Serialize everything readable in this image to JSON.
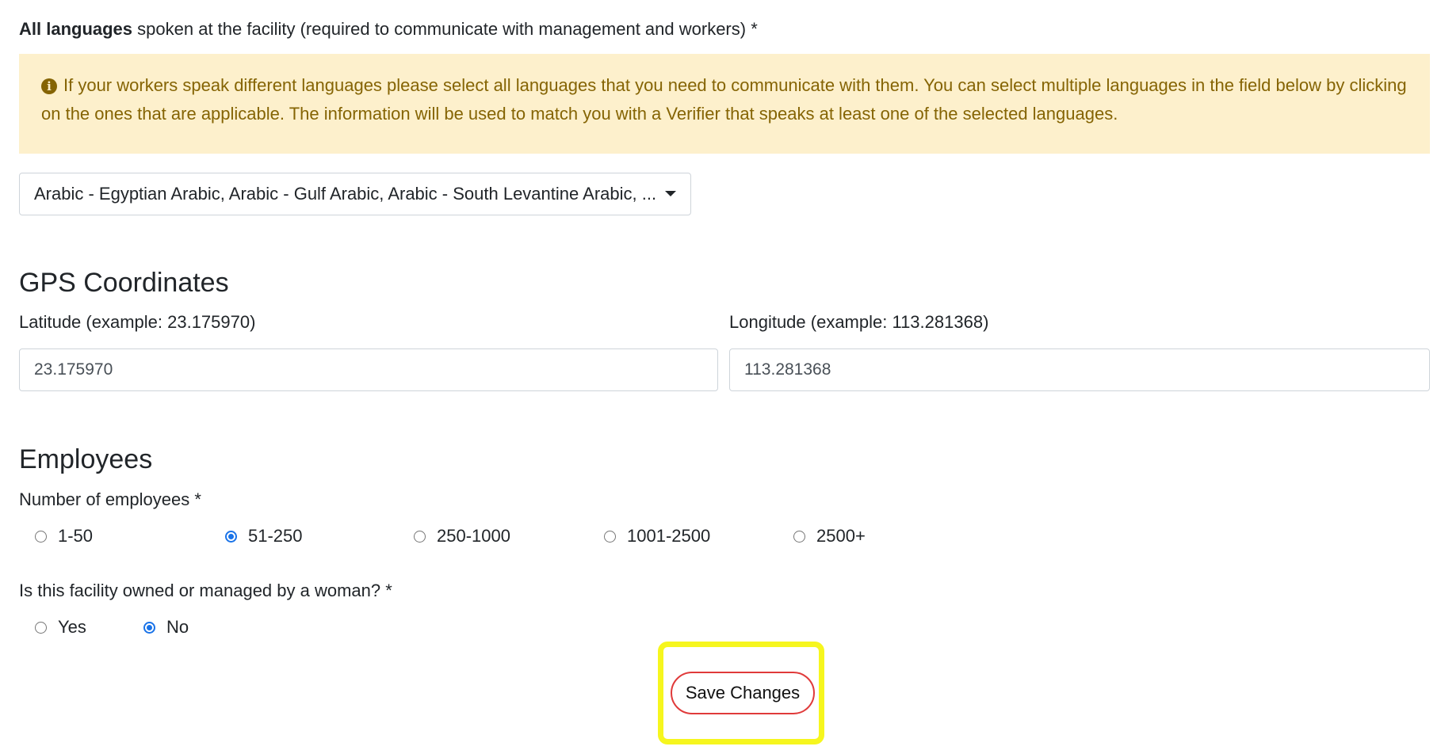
{
  "languages": {
    "label_bold": "All languages",
    "label_rest": " spoken at the facility (required to communicate with management and workers) *",
    "alert_text": "If your workers speak different languages please select all languages that you need to communicate with them. You can select multiple languages in the field below by clicking on the ones that are applicable. The information will be used to match you with a Verifier that speaks at least one of the selected languages.",
    "select_value": "Arabic - Egyptian Arabic, Arabic - Gulf Arabic, Arabic - South Levantine Arabic, ...",
    "info_icon_glyph": "i"
  },
  "gps": {
    "title": "GPS Coordinates",
    "latitude_label": "Latitude (example: 23.175970)",
    "latitude_value": "23.175970",
    "longitude_label": "Longitude (example: 113.281368)",
    "longitude_value": "113.281368"
  },
  "employees": {
    "title": "Employees",
    "count_label": "Number of employees *",
    "count_options": [
      "1-50",
      "51-250",
      "250-1000",
      "1001-2500",
      "2500+"
    ],
    "count_selected": "51-250",
    "woman_label": "Is this facility owned or managed by a woman? *",
    "woman_options": [
      "Yes",
      "No"
    ],
    "woman_selected": "No"
  },
  "save_button": {
    "label": "Save Changes",
    "highlight_color": "#f6f61e",
    "border_color": "#e03a3a"
  },
  "colors": {
    "alert_bg": "#fdf0cc",
    "alert_text": "#856404",
    "radio_selected": "#1a73e8"
  }
}
